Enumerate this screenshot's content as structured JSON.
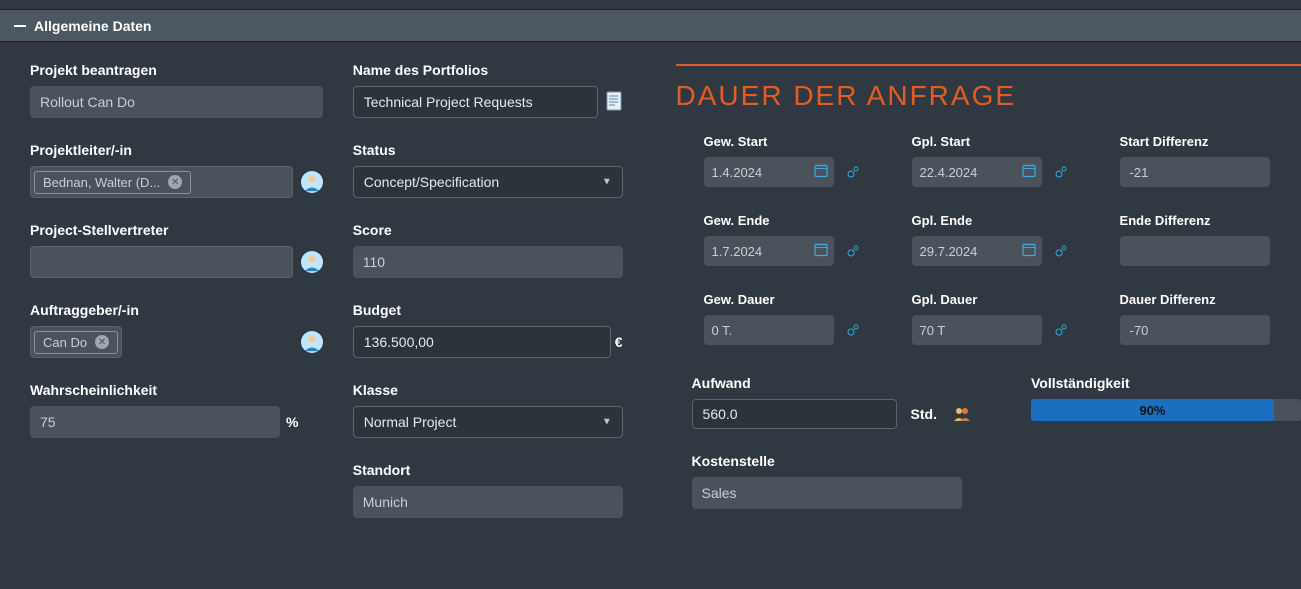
{
  "section_title": "Allgemeine Daten",
  "col1": {
    "projekt_beantragen_label": "Projekt beantragen",
    "projekt_beantragen_value": "Rollout Can Do",
    "projektleiter_label": "Projektleiter/-in",
    "projektleiter_tag": "Bednan, Walter (D...",
    "stellvertreter_label": "Project-Stellvertreter",
    "auftraggeber_label": "Auftraggeber/-in",
    "auftraggeber_tag": "Can Do",
    "wahrscheinlichkeit_label": "Wahrscheinlichkeit",
    "wahrscheinlichkeit_value": "75",
    "percent": "%"
  },
  "col2": {
    "portfolio_label": "Name des Portfolios",
    "portfolio_value": "Technical Project Requests",
    "status_label": "Status",
    "status_value": "Concept/Specification",
    "score_label": "Score",
    "score_value": "110",
    "budget_label": "Budget",
    "budget_value": "136.500,00",
    "euro": "€",
    "klasse_label": "Klasse",
    "klasse_value": "Normal Project",
    "standort_label": "Standort",
    "standort_value": "Munich"
  },
  "col3": {
    "title": "DAUER DER ANFRAGE",
    "labels": {
      "gew_start": "Gew. Start",
      "gpl_start": "Gpl. Start",
      "start_diff": "Start Differenz",
      "gew_ende": "Gew. Ende",
      "gpl_ende": "Gpl. Ende",
      "ende_diff": "Ende Differenz",
      "gew_dauer": "Gew. Dauer",
      "gpl_dauer": "Gpl. Dauer",
      "dauer_diff": "Dauer Differenz",
      "aufwand": "Aufwand",
      "vollstaendigkeit": "Vollständigkeit",
      "kostenstelle": "Kostenstelle"
    },
    "gew_start": "1.4.2024",
    "gpl_start": "22.4.2024",
    "start_diff": "-21",
    "gew_ende": "1.7.2024",
    "gpl_ende": "29.7.2024",
    "ende_diff": "",
    "gew_dauer": "0 T.",
    "gpl_dauer": "70 T",
    "dauer_diff": "-70",
    "aufwand": "560.0",
    "std": "Std.",
    "progress_pct": 90,
    "progress_label": "90%",
    "kostenstelle": "Sales"
  }
}
